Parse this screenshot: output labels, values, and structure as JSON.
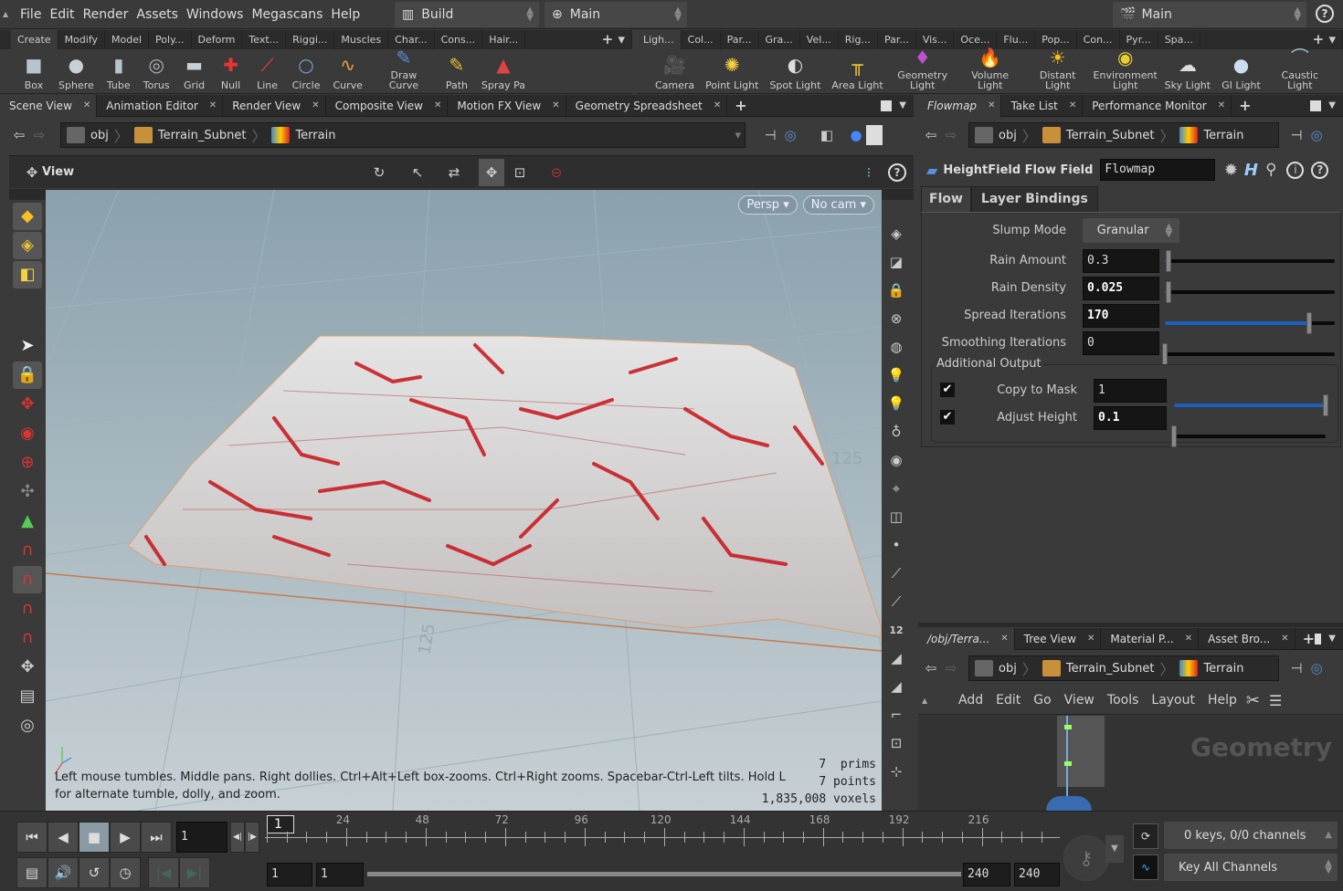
{
  "menu": [
    "File",
    "Edit",
    "Render",
    "Assets",
    "Windows",
    "Megascans",
    "Help"
  ],
  "desktop": "Build",
  "context": "Main",
  "main_right": "Main",
  "shelf_left": {
    "tabs": [
      "Create",
      "Modify",
      "Model",
      "Poly...",
      "Deform",
      "Text...",
      "Riggi...",
      "Muscles",
      "Char...",
      "Cons...",
      "Hair..."
    ],
    "tools": [
      {
        "label": "Box",
        "icon": "box-icon",
        "g": "■",
        "c": "#b8c4cc"
      },
      {
        "label": "Sphere",
        "icon": "sphere-icon",
        "g": "●",
        "c": "#c8d0d6"
      },
      {
        "label": "Tube",
        "icon": "tube-icon",
        "g": "▮",
        "c": "#b8c4cc"
      },
      {
        "label": "Torus",
        "icon": "torus-icon",
        "g": "◎",
        "c": "#a8b4bc"
      },
      {
        "label": "Grid",
        "icon": "grid-icon",
        "g": "▬",
        "c": "#c8d0d6"
      },
      {
        "label": "Null",
        "icon": "null-icon",
        "g": "✚",
        "c": "#e33"
      },
      {
        "label": "Line",
        "icon": "line-icon",
        "g": "⟋",
        "c": "#e44"
      },
      {
        "label": "Circle",
        "icon": "circle-icon",
        "g": "○",
        "c": "#7aa0d0"
      },
      {
        "label": "Curve",
        "icon": "curve-icon",
        "g": "∿",
        "c": "#e9a440"
      },
      {
        "label": "Draw Curve",
        "icon": "draw-curve-icon",
        "g": "✎",
        "c": "#5a8fe0"
      },
      {
        "label": "Path",
        "icon": "path-icon",
        "g": "✎",
        "c": "#e8c030"
      },
      {
        "label": "Spray Pa",
        "icon": "spray-paint-icon",
        "g": "▲",
        "c": "#d44"
      }
    ]
  },
  "shelf_right": {
    "tabs": [
      "Ligh...",
      "Col...",
      "Par...",
      "Gra...",
      "Vel...",
      "Rig...",
      "Par...",
      "Vis...",
      "Oce...",
      "Flu...",
      "Pop...",
      "Con...",
      "Pyr...",
      "Spa..."
    ],
    "tools": [
      {
        "label": "Camera",
        "icon": "camera-icon",
        "g": "🎥",
        "c": "#999"
      },
      {
        "label": "Point Light",
        "icon": "point-light-icon",
        "g": "✺",
        "c": "#f5d040"
      },
      {
        "label": "Spot Light",
        "icon": "spot-light-icon",
        "g": "◐",
        "c": "#ddd"
      },
      {
        "label": "Area Light",
        "icon": "area-light-icon",
        "g": "╥",
        "c": "#e8c030"
      },
      {
        "label": "Geometry Light",
        "icon": "geometry-light-icon",
        "g": "♦",
        "c": "#c050d0"
      },
      {
        "label": "Volume Light",
        "icon": "volume-light-icon",
        "g": "🔥",
        "c": "#f60"
      },
      {
        "label": "Distant Light",
        "icon": "distant-light-icon",
        "g": "☀",
        "c": "#f5c020"
      },
      {
        "label": "Environment Light",
        "icon": "environment-light-icon",
        "g": "◉",
        "c": "#e8d030"
      },
      {
        "label": "Sky Light",
        "icon": "sky-light-icon",
        "g": "☁",
        "c": "#ddd"
      },
      {
        "label": "GI Light",
        "icon": "gi-light-icon",
        "g": "●",
        "c": "#cde"
      },
      {
        "label": "Caustic Light",
        "icon": "caustic-light-icon",
        "g": "⌒",
        "c": "#9bc"
      }
    ]
  },
  "left_tabs": [
    "Scene View",
    "Animation Editor",
    "Render View",
    "Composite View",
    "Motion FX View",
    "Geometry Spreadsheet"
  ],
  "right_tabs": [
    "Flowmap",
    "Take List",
    "Performance Monitor"
  ],
  "path": [
    "obj",
    "Terrain_Subnet",
    "Terrain"
  ],
  "viewport": {
    "title": "View",
    "persp": "Persp",
    "cam": "No cam",
    "axis_label_a": "125",
    "axis_label_b": "125",
    "hint": "Left mouse tumbles. Middle pans. Right dollies. Ctrl+Alt+Left box-zooms. Ctrl+Right zooms. Spacebar-Ctrl-Left tilts. Hold L for alternate tumble, dolly, and zoom.",
    "stats": [
      "7  prims",
      "7 points",
      "1,835,008 voxels"
    ]
  },
  "params": {
    "node_type": "HeightField Flow Field",
    "node_name": "Flowmap",
    "tabs": [
      "Flow",
      "Layer Bindings"
    ],
    "slump_label": "Slump Mode",
    "slump_value": "Granular",
    "rows": [
      {
        "label": "Rain Amount",
        "value": "0.3",
        "frac": 0.02,
        "bold": false
      },
      {
        "label": "Rain Density",
        "value": "0.025",
        "frac": 0.02,
        "bold": true
      },
      {
        "label": "Spread Iterations",
        "value": "170",
        "frac": 0.85,
        "bold": true
      },
      {
        "label": "Smoothing Iterations",
        "value": "0",
        "frac": 0,
        "bold": false
      }
    ],
    "group": "Additional Output",
    "outputs": [
      {
        "label": "Copy to Mask",
        "value": "1",
        "frac": 1,
        "checked": true
      },
      {
        "label": "Adjust Height",
        "value": "0.1",
        "frac": 0,
        "checked": true
      }
    ]
  },
  "net_tabs": [
    "/obj/Terra...",
    "Tree View",
    "Material P...",
    "Asset Bro..."
  ],
  "net_menu": [
    "Add",
    "Edit",
    "Go",
    "View",
    "Tools",
    "Layout",
    "Help"
  ],
  "net_watermark": "Geometry",
  "timeline": {
    "current": "1",
    "frame_field": "1",
    "ticks": [
      24,
      48,
      72,
      96,
      120,
      144,
      168,
      192,
      216
    ],
    "start": "1",
    "start2": "1",
    "end": "240",
    "end2": "240",
    "keys": "0 keys, 0/0 channels",
    "key_all": "Key All Channels"
  },
  "colors": {
    "accent": "#1f5fbf",
    "panel": "#3a3a3a"
  }
}
